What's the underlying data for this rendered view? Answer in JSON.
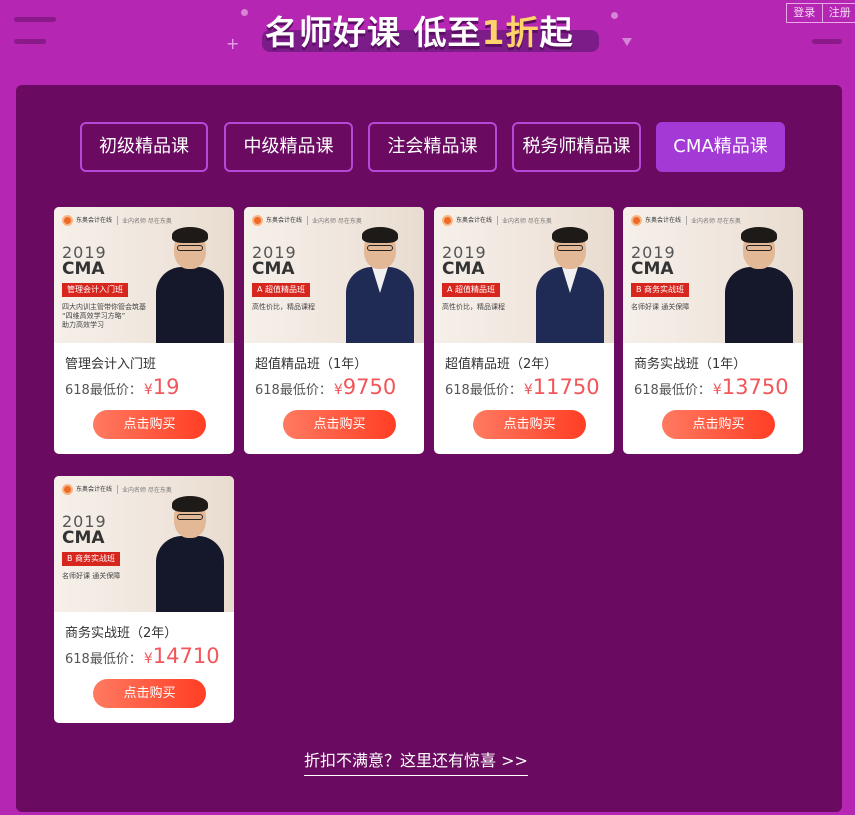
{
  "banner": {
    "title_part1": "名师好课 低至",
    "title_highlight": "1折",
    "title_part2": "起"
  },
  "header_links": {
    "login": "登录",
    "register": "注册"
  },
  "tabs": [
    {
      "label": "初级精品课",
      "active": false
    },
    {
      "label": "中级精品课",
      "active": false
    },
    {
      "label": "注会精品课",
      "active": false
    },
    {
      "label": "税务师精品课",
      "active": false
    },
    {
      "label": "CMA精品课",
      "active": true
    }
  ],
  "price_prefix": "618最低价：",
  "currency": "¥",
  "buy_label": "点击购买",
  "courses": [
    {
      "title": "管理会计入门班",
      "price": "19",
      "thumb": {
        "logo": "东奥会计在线",
        "slogan": "业内名师 尽在东奥",
        "year": "2019",
        "exam": "CMA",
        "tag": "管理会计入门班",
        "sub": "四大内训主管带你管会筑基\n“四维高效学习方略”\n助力高效学习"
      }
    },
    {
      "title": "超值精品班（1年）",
      "price": "9750",
      "thumb": {
        "logo": "东奥会计在线",
        "slogan": "业内名师 尽在东奥",
        "year": "2019",
        "exam": "CMA",
        "tag": "A 超值精品班",
        "sub": "高性价比，精品课程"
      }
    },
    {
      "title": "超值精品班（2年）",
      "price": "11750",
      "thumb": {
        "logo": "东奥会计在线",
        "slogan": "业内名师 尽在东奥",
        "year": "2019",
        "exam": "CMA",
        "tag": "A 超值精品班",
        "sub": "高性价比，精品课程"
      }
    },
    {
      "title": "商务实战班（1年）",
      "price": "13750",
      "thumb": {
        "logo": "东奥会计在线",
        "slogan": "业内名师 尽在东奥",
        "year": "2019",
        "exam": "CMA",
        "tag": "B 商务实战班",
        "sub": "名师好课 通关保障"
      }
    },
    {
      "title": "商务实战班（2年）",
      "price": "14710",
      "thumb": {
        "logo": "东奥会计在线",
        "slogan": "业内名师 尽在东奥",
        "year": "2019",
        "exam": "CMA",
        "tag": "B 商务实战班",
        "sub": "名师好课 通关保障"
      }
    }
  ],
  "more_link": "折扣不满意？这里还有惊喜 >>",
  "colors": {
    "page_bg": "#b526b3",
    "panel_bg": "#6a0a60",
    "tab_active": "#a43ad6",
    "price": "#f2565a",
    "buy_button": "#ff5a3c"
  }
}
